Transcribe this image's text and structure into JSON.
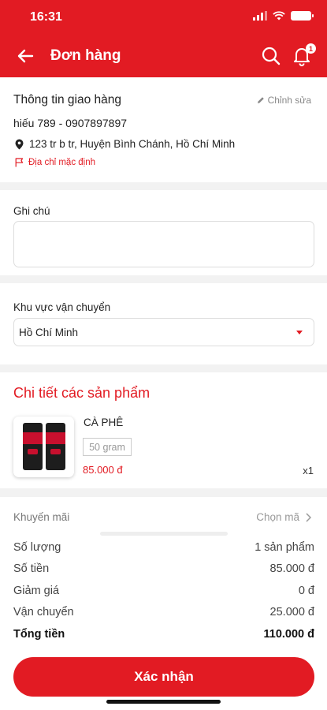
{
  "status_bar": {
    "time": "16:31"
  },
  "header": {
    "title": "Đơn hàng",
    "notification_count": "1"
  },
  "shipping": {
    "title": "Thông tin giao hàng",
    "edit_label": "Chỉnh sửa",
    "contact": "hiếu 789 - 0907897897",
    "address": "123 tr b tr, Huyện Bình Chánh, Hồ Chí Minh",
    "default_label": "Địa chỉ mặc định"
  },
  "note": {
    "label": "Ghi chú",
    "value": ""
  },
  "region": {
    "label": "Khu vực vận chuyển",
    "selected": "Hồ Chí Minh"
  },
  "products": {
    "title": "Chi tiết các sản phẩm",
    "items": [
      {
        "name": "CÀ PHÊ",
        "variant": "50 gram",
        "price": "85.000 đ",
        "quantity": "x1"
      }
    ]
  },
  "summary": {
    "promo_label": "Khuyến mãi",
    "promo_action": "Chọn mã",
    "rows": [
      {
        "label": "Số lượng",
        "value": "1 sản phẩm"
      },
      {
        "label": "Số tiền",
        "value": "85.000 đ"
      },
      {
        "label": "Giảm giá",
        "value": "0 đ"
      },
      {
        "label": "Vận chuyển",
        "value": "25.000 đ"
      },
      {
        "label": "Tổng tiền",
        "value": "110.000 đ"
      }
    ]
  },
  "confirm_label": "Xác nhận",
  "colors": {
    "accent": "#e21b23",
    "background": "#f2f2f2"
  }
}
